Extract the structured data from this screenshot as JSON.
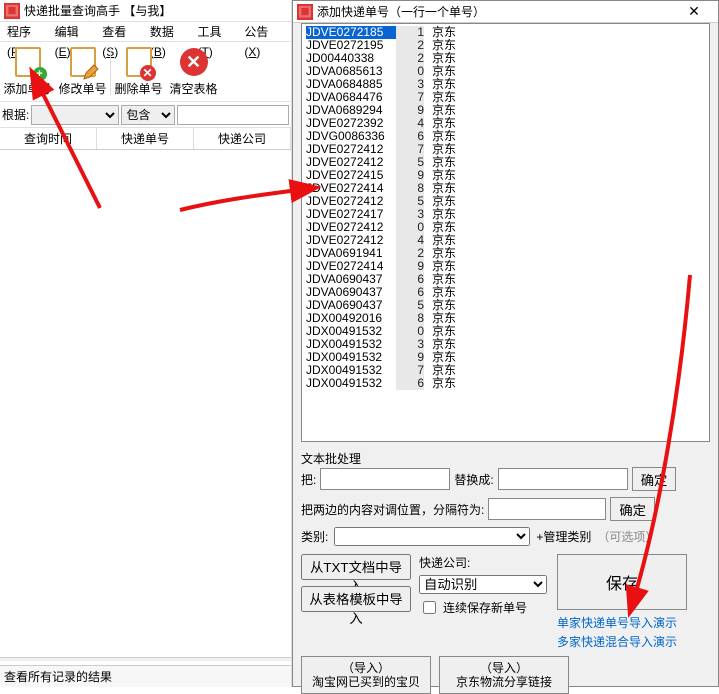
{
  "main": {
    "title": "快递批量查询高手 【与我】",
    "menu": [
      {
        "label": "程序",
        "key": "P"
      },
      {
        "label": "编辑",
        "key": "E"
      },
      {
        "label": "查看",
        "key": "S"
      },
      {
        "label": "数据",
        "key": "B"
      },
      {
        "label": "工具",
        "key": "T"
      },
      {
        "label": "公告",
        "key": "X"
      }
    ],
    "tools": {
      "add": "添加单号",
      "edit": "修改单号",
      "del": "删除单号",
      "clear": "清空表格"
    },
    "filter": {
      "label": "根据:",
      "contain": "包含"
    },
    "columns": [
      "查询时间",
      "快递单号",
      "快递公司"
    ],
    "status": "查看所有记录的结果"
  },
  "dialog": {
    "title": "添加快递单号（一行一个单号）",
    "rows": [
      {
        "no": "JDVE0272185",
        "d": "1",
        "c": "京东",
        "sel": true
      },
      {
        "no": "JDVE0272195",
        "d": "2",
        "c": "京东"
      },
      {
        "no": "JD00440338",
        "d": "2",
        "c": "京东"
      },
      {
        "no": "JDVA0685613",
        "d": "0",
        "c": "京东"
      },
      {
        "no": "JDVA0684885",
        "d": "3",
        "c": "京东"
      },
      {
        "no": "JDVA0684476",
        "d": "7",
        "c": "京东"
      },
      {
        "no": "JDVA0689294",
        "d": "9",
        "c": "京东"
      },
      {
        "no": "JDVE0272392",
        "d": "4",
        "c": "京东"
      },
      {
        "no": "JDVG0086336",
        "d": "6",
        "c": "京东"
      },
      {
        "no": "JDVE0272412",
        "d": "7",
        "c": "京东"
      },
      {
        "no": "JDVE0272412",
        "d": "5",
        "c": "京东"
      },
      {
        "no": "JDVE0272415",
        "d": "9",
        "c": "京东"
      },
      {
        "no": "JDVE0272414",
        "d": "8",
        "c": "京东"
      },
      {
        "no": "JDVE0272412",
        "d": "5",
        "c": "京东"
      },
      {
        "no": "JDVE0272417",
        "d": "3",
        "c": "京东"
      },
      {
        "no": "JDVE0272412",
        "d": "0",
        "c": "京东"
      },
      {
        "no": "JDVE0272412",
        "d": "4",
        "c": "京东"
      },
      {
        "no": "JDVA0691941",
        "d": "2",
        "c": "京东"
      },
      {
        "no": "JDVE0272414",
        "d": "9",
        "c": "京东"
      },
      {
        "no": "JDVA0690437",
        "d": "6",
        "c": "京东"
      },
      {
        "no": "JDVA0690437",
        "d": "6",
        "c": "京东"
      },
      {
        "no": "JDVA0690437",
        "d": "5",
        "c": "京东"
      },
      {
        "no": "JDX00492016",
        "d": "8",
        "c": "京东"
      },
      {
        "no": "JDX00491532",
        "d": "0",
        "c": "京东"
      },
      {
        "no": "JDX00491532",
        "d": "3",
        "c": "京东"
      },
      {
        "no": "JDX00491532",
        "d": "9",
        "c": "京东"
      },
      {
        "no": "JDX00491532",
        "d": "7",
        "c": "京东"
      },
      {
        "no": "JDX00491532",
        "d": "6",
        "c": "京东"
      }
    ],
    "batch": {
      "title": "文本批处理",
      "replace_label": "把:",
      "replace_to": "替换成:",
      "swap_label": "把两边的内容对调位置，分隔符为:",
      "confirm": "确定"
    },
    "category": {
      "label": "类别:",
      "manage": "+管理类别",
      "optional": "（可选项）"
    },
    "buttons": {
      "from_txt": "从TXT文档中导入",
      "from_tpl": "从表格模板中导入",
      "courier_label": "快递公司:",
      "auto_detect": "自动识别",
      "continuous_save": "连续保存新单号",
      "save": "保存"
    },
    "imports": {
      "taobao_top": "（导入）",
      "taobao": "淘宝网已买到的宝贝",
      "jd_top": "（导入）",
      "jd": "京东物流分享链接"
    },
    "links": {
      "single": "单家快递单号导入演示",
      "multi": "多家快递混合导入演示"
    }
  }
}
